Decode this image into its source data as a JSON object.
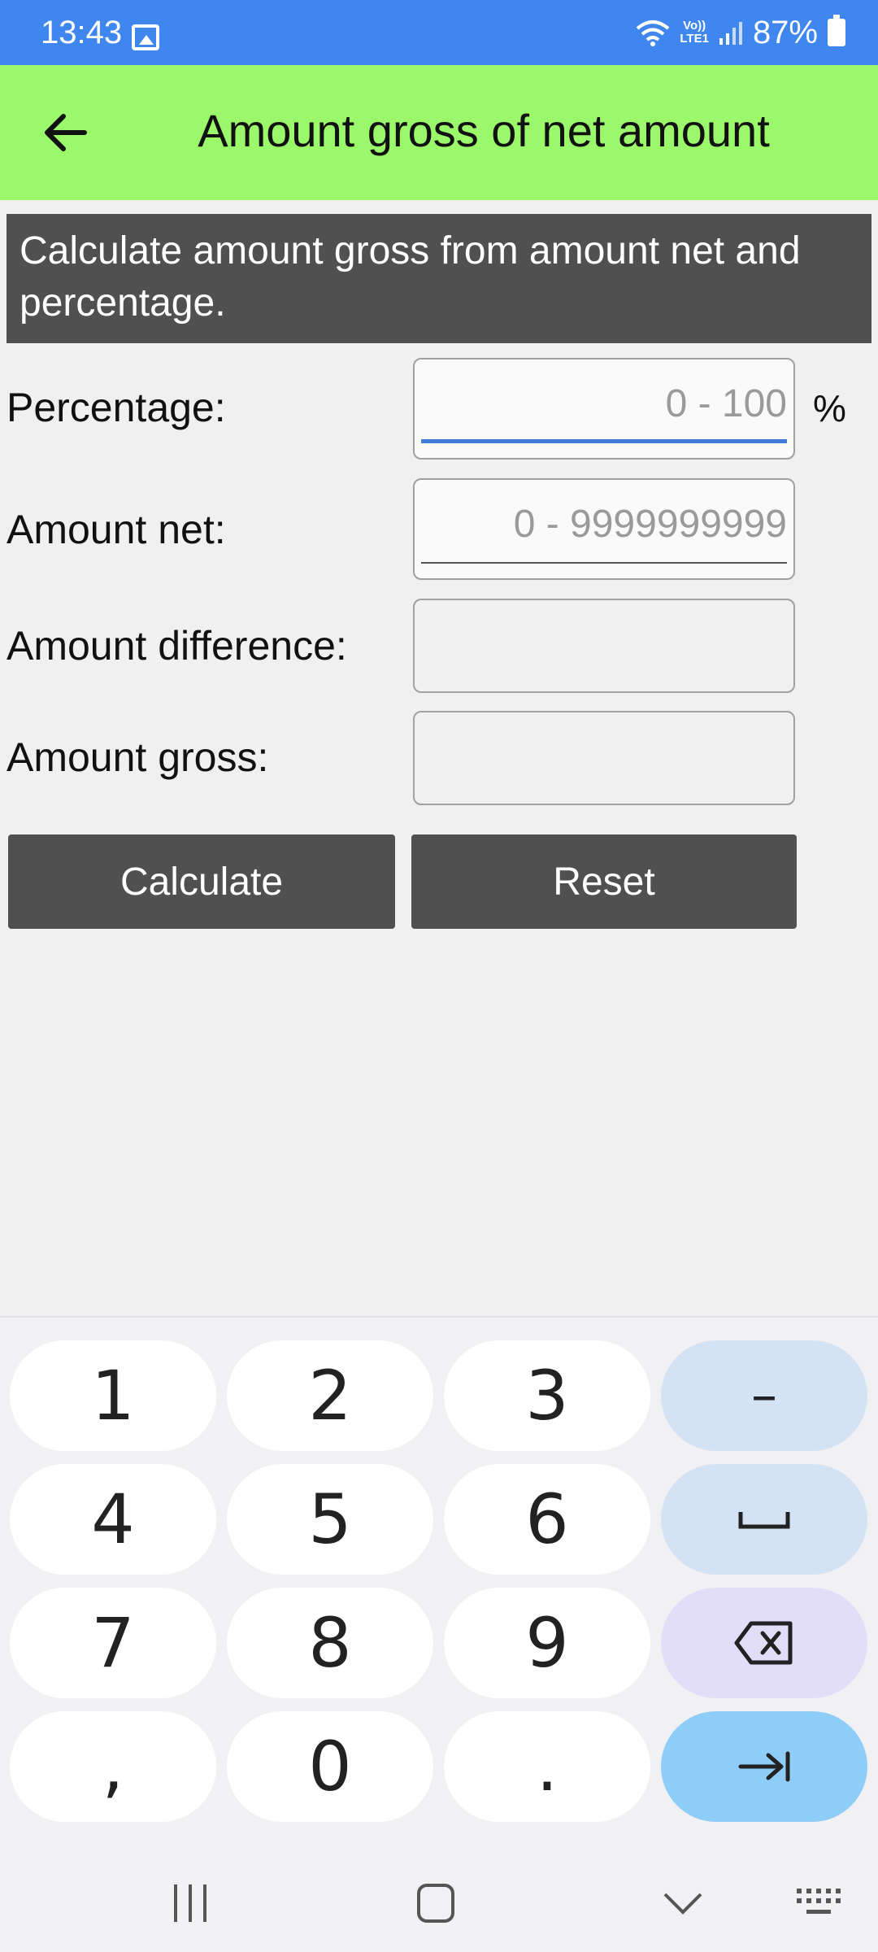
{
  "status_bar": {
    "time": "13:43",
    "battery": "87%",
    "volte_top": "Vo))",
    "volte_bottom": "LTE1"
  },
  "app_bar": {
    "title": "Amount gross of net amount",
    "back_icon": "arrow-left-icon"
  },
  "description": "Calculate amount gross from amount net and percentage.",
  "form": {
    "percentage": {
      "label": "Percentage:",
      "placeholder": "0 - 100",
      "value": "",
      "unit": "%"
    },
    "amount_net": {
      "label": "Amount net:",
      "placeholder": "0 - 9999999999",
      "value": ""
    },
    "amount_difference": {
      "label": "Amount difference:",
      "value": ""
    },
    "amount_gross": {
      "label": "Amount gross:",
      "value": ""
    }
  },
  "buttons": {
    "calculate": "Calculate",
    "reset": "Reset"
  },
  "keyboard": {
    "keys": [
      "1",
      "2",
      "3",
      "–",
      "4",
      "5",
      "6",
      "␣",
      "7",
      "8",
      "9",
      "⌫",
      ",",
      "0",
      ".",
      "⇥"
    ]
  },
  "colors": {
    "status_bar": "#3f86ee",
    "app_bar": "#9bf86a",
    "dark_panel": "#505050"
  }
}
